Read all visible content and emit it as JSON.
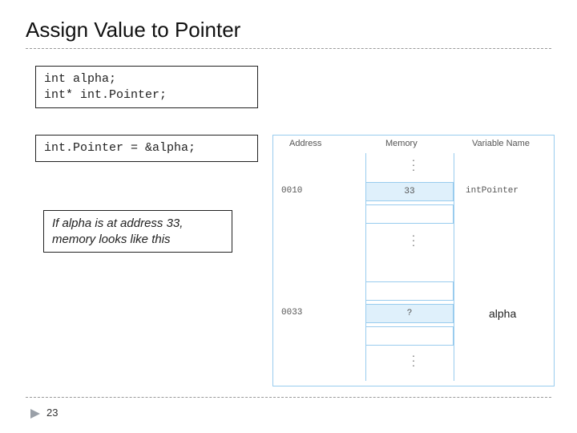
{
  "title": "Assign Value to Pointer",
  "code1": "int alpha;\nint* int.Pointer;",
  "code2": "int.Pointer = &alpha;",
  "note": "If alpha is at address 33, memory looks like this",
  "diagram": {
    "headers": {
      "address": "Address",
      "memory": "Memory",
      "varname": "Variable Name"
    },
    "row1": {
      "addr": "0010",
      "mem": "33",
      "var": "intPointer"
    },
    "row2": {
      "addr": "0033",
      "mem": "?",
      "var": ""
    }
  },
  "alpha_label": "alpha",
  "page_number": "23"
}
